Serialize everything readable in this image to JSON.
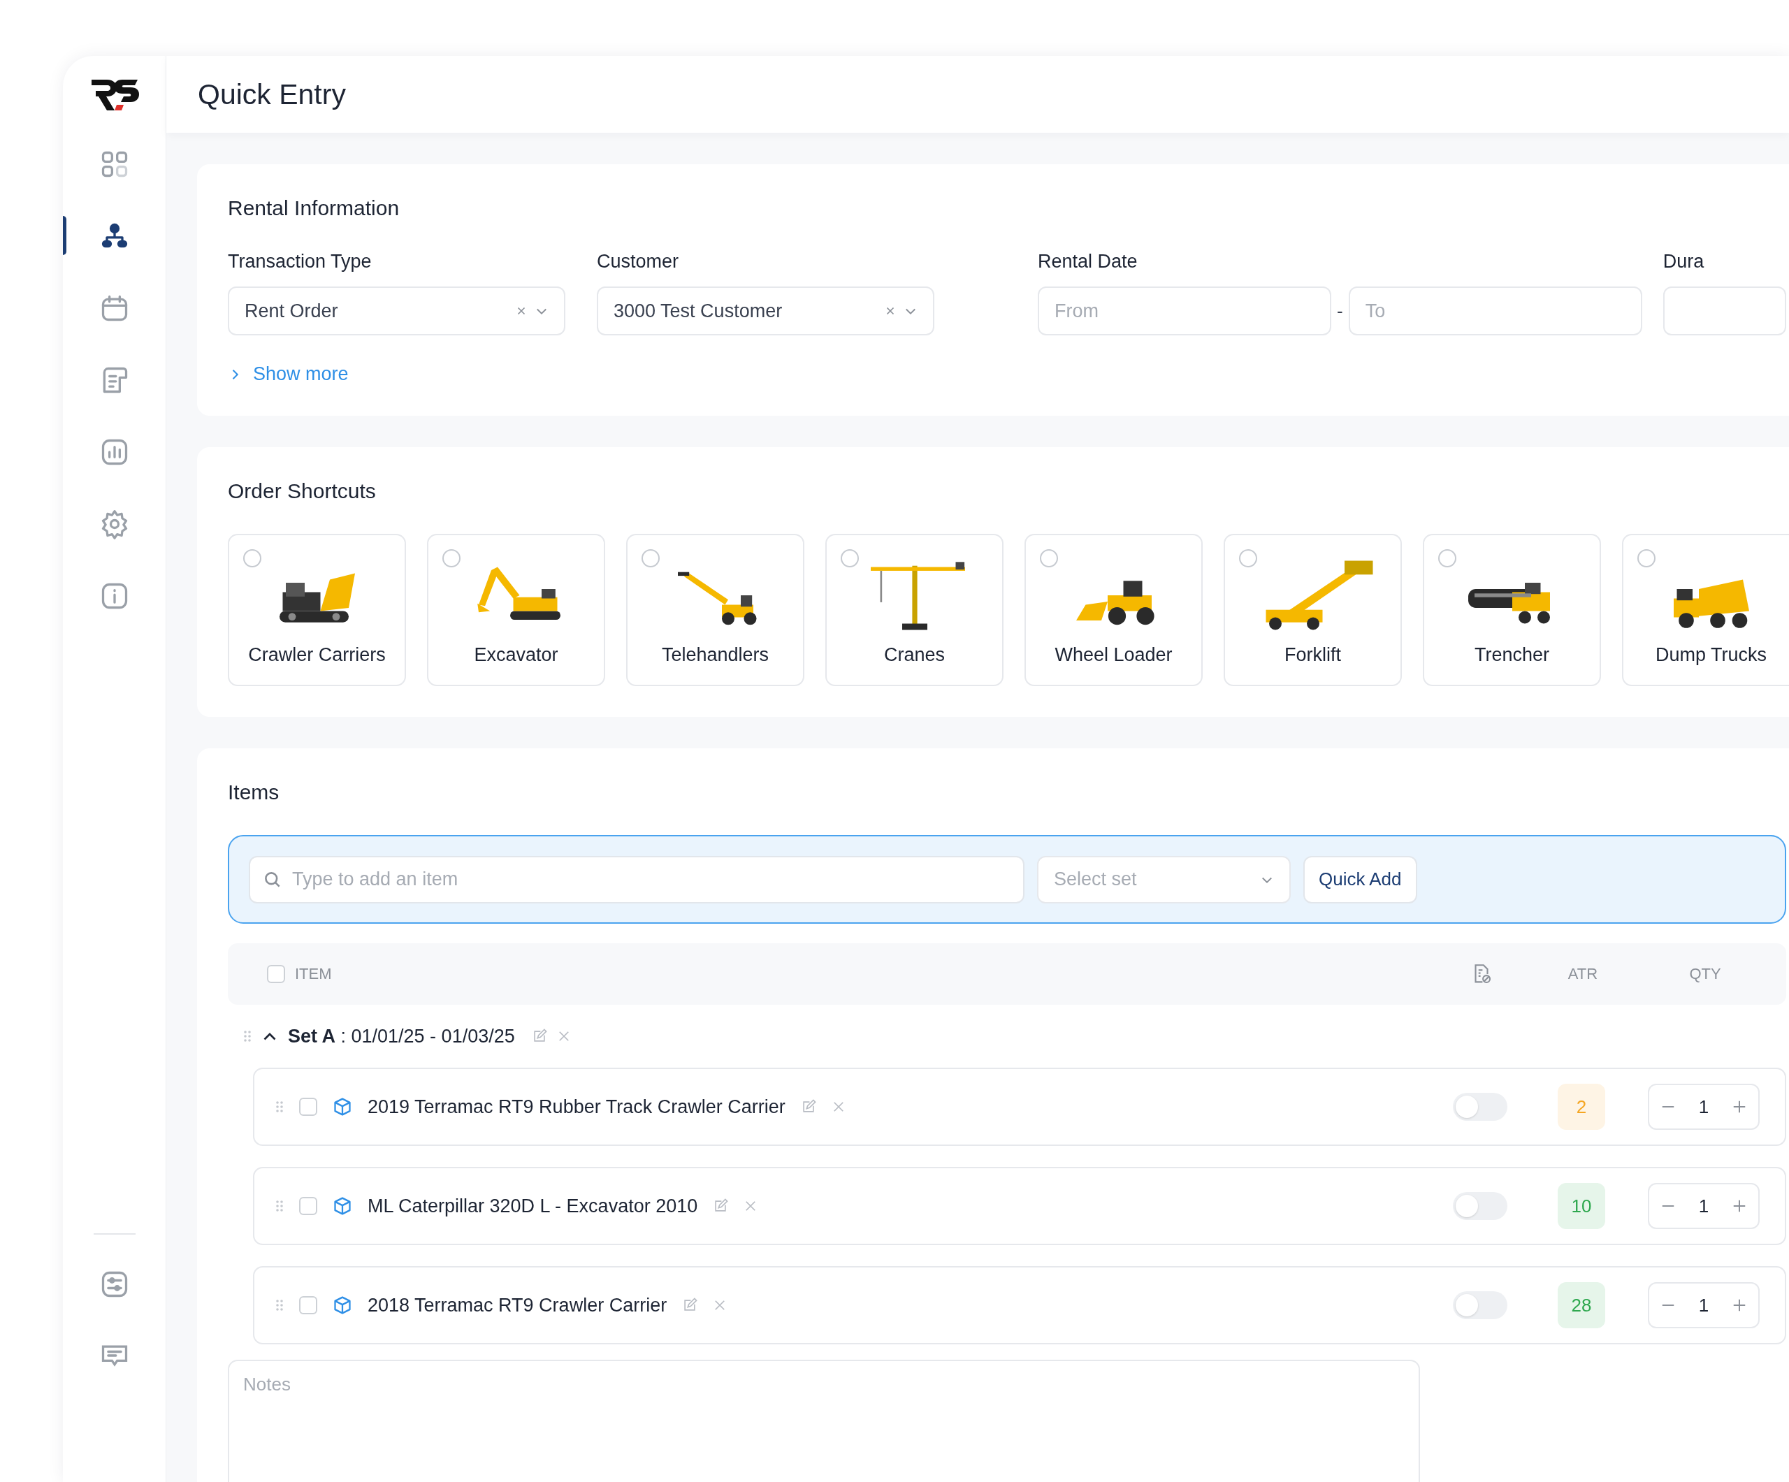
{
  "header": {
    "title": "Quick Entry"
  },
  "sidebar": {
    "items": [
      {
        "kind": "dashboard",
        "selected": false
      },
      {
        "kind": "orders",
        "selected": true
      },
      {
        "kind": "calendar",
        "selected": false
      },
      {
        "kind": "documents",
        "selected": false
      },
      {
        "kind": "reports",
        "selected": false
      },
      {
        "kind": "settings",
        "selected": false
      },
      {
        "kind": "info",
        "selected": false
      }
    ],
    "bottom_items": [
      {
        "kind": "filters",
        "selected": false
      },
      {
        "kind": "messages",
        "selected": false
      }
    ]
  },
  "rental": {
    "title": "Rental Information",
    "transaction_type": {
      "label": "Transaction Type",
      "value": "Rent Order"
    },
    "customer": {
      "label": "Customer",
      "value": "3000 Test Customer"
    },
    "rental_date": {
      "label": "Rental Date",
      "from_placeholder": "From",
      "separator": "-",
      "to_placeholder": "To"
    },
    "duration": {
      "label": "Dura"
    },
    "show_more": "Show more"
  },
  "shortcuts": {
    "title": "Order Shortcuts",
    "items": [
      {
        "label": "Crawler Carriers",
        "selected": false
      },
      {
        "label": "Excavator",
        "selected": false
      },
      {
        "label": "Telehandlers",
        "selected": false
      },
      {
        "label": "Cranes",
        "selected": false
      },
      {
        "label": "Wheel Loader",
        "selected": false
      },
      {
        "label": "Forklift",
        "selected": false
      },
      {
        "label": "Trencher",
        "selected": false
      },
      {
        "label": "Dump Trucks",
        "selected": false
      }
    ]
  },
  "items": {
    "title": "Items",
    "search_placeholder": "Type to add an item",
    "set_placeholder": "Select set",
    "quick_add": "Quick Add",
    "columns": {
      "item": "ITEM",
      "atr": "ATR",
      "qty": "QTY"
    },
    "select_all_checked": false,
    "set": {
      "title": "**Set A** : 01/01/25 - 01/03/25",
      "expanded": true,
      "rows": [
        {
          "name": "2019 Terramac RT9 Rubber Track Crawler Carrier",
          "checked": false,
          "on": false,
          "atr": "2",
          "color": "#f5a623",
          "qty": "1"
        },
        {
          "name": "ML Caterpillar 320D L - Excavator 2010",
          "checked": false,
          "on": false,
          "atr": "10",
          "color": "#2fa84f",
          "qty": "1"
        },
        {
          "name": "2018 Terramac RT9 Crawler Carrier",
          "checked": false,
          "on": false,
          "atr": "28",
          "color": "#2fa84f",
          "qty": "1"
        }
      ]
    },
    "notes_placeholder": "Notes"
  }
}
